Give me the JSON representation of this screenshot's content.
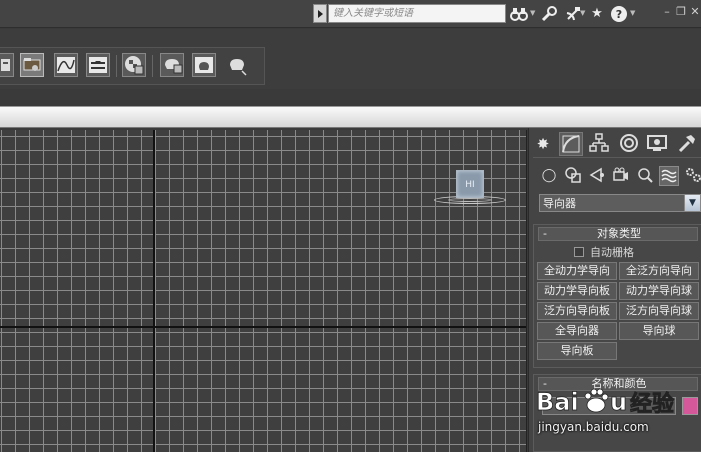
{
  "search": {
    "placeholder": "键入关键字或短语"
  },
  "command_panel": {
    "subcategory": "导向器",
    "object_type": {
      "title": "对象类型",
      "collapse_symbol": "-",
      "autogrid_label": "自动栅格",
      "buttons": [
        "全动力学导向",
        "全泛方向导向",
        "动力学导向板",
        "动力学导向球",
        "泛方向导向板",
        "泛方向导向球",
        "全导向器",
        "导向球",
        "导向板"
      ]
    },
    "name_color": {
      "title": "名称和颜色",
      "collapse_symbol": "-",
      "swatch_color": "#d4589a"
    }
  },
  "viewport": {
    "helper_label": "HI"
  },
  "watermark": {
    "logo": "Baidu经验",
    "url": "jingyan.baidu.com"
  }
}
